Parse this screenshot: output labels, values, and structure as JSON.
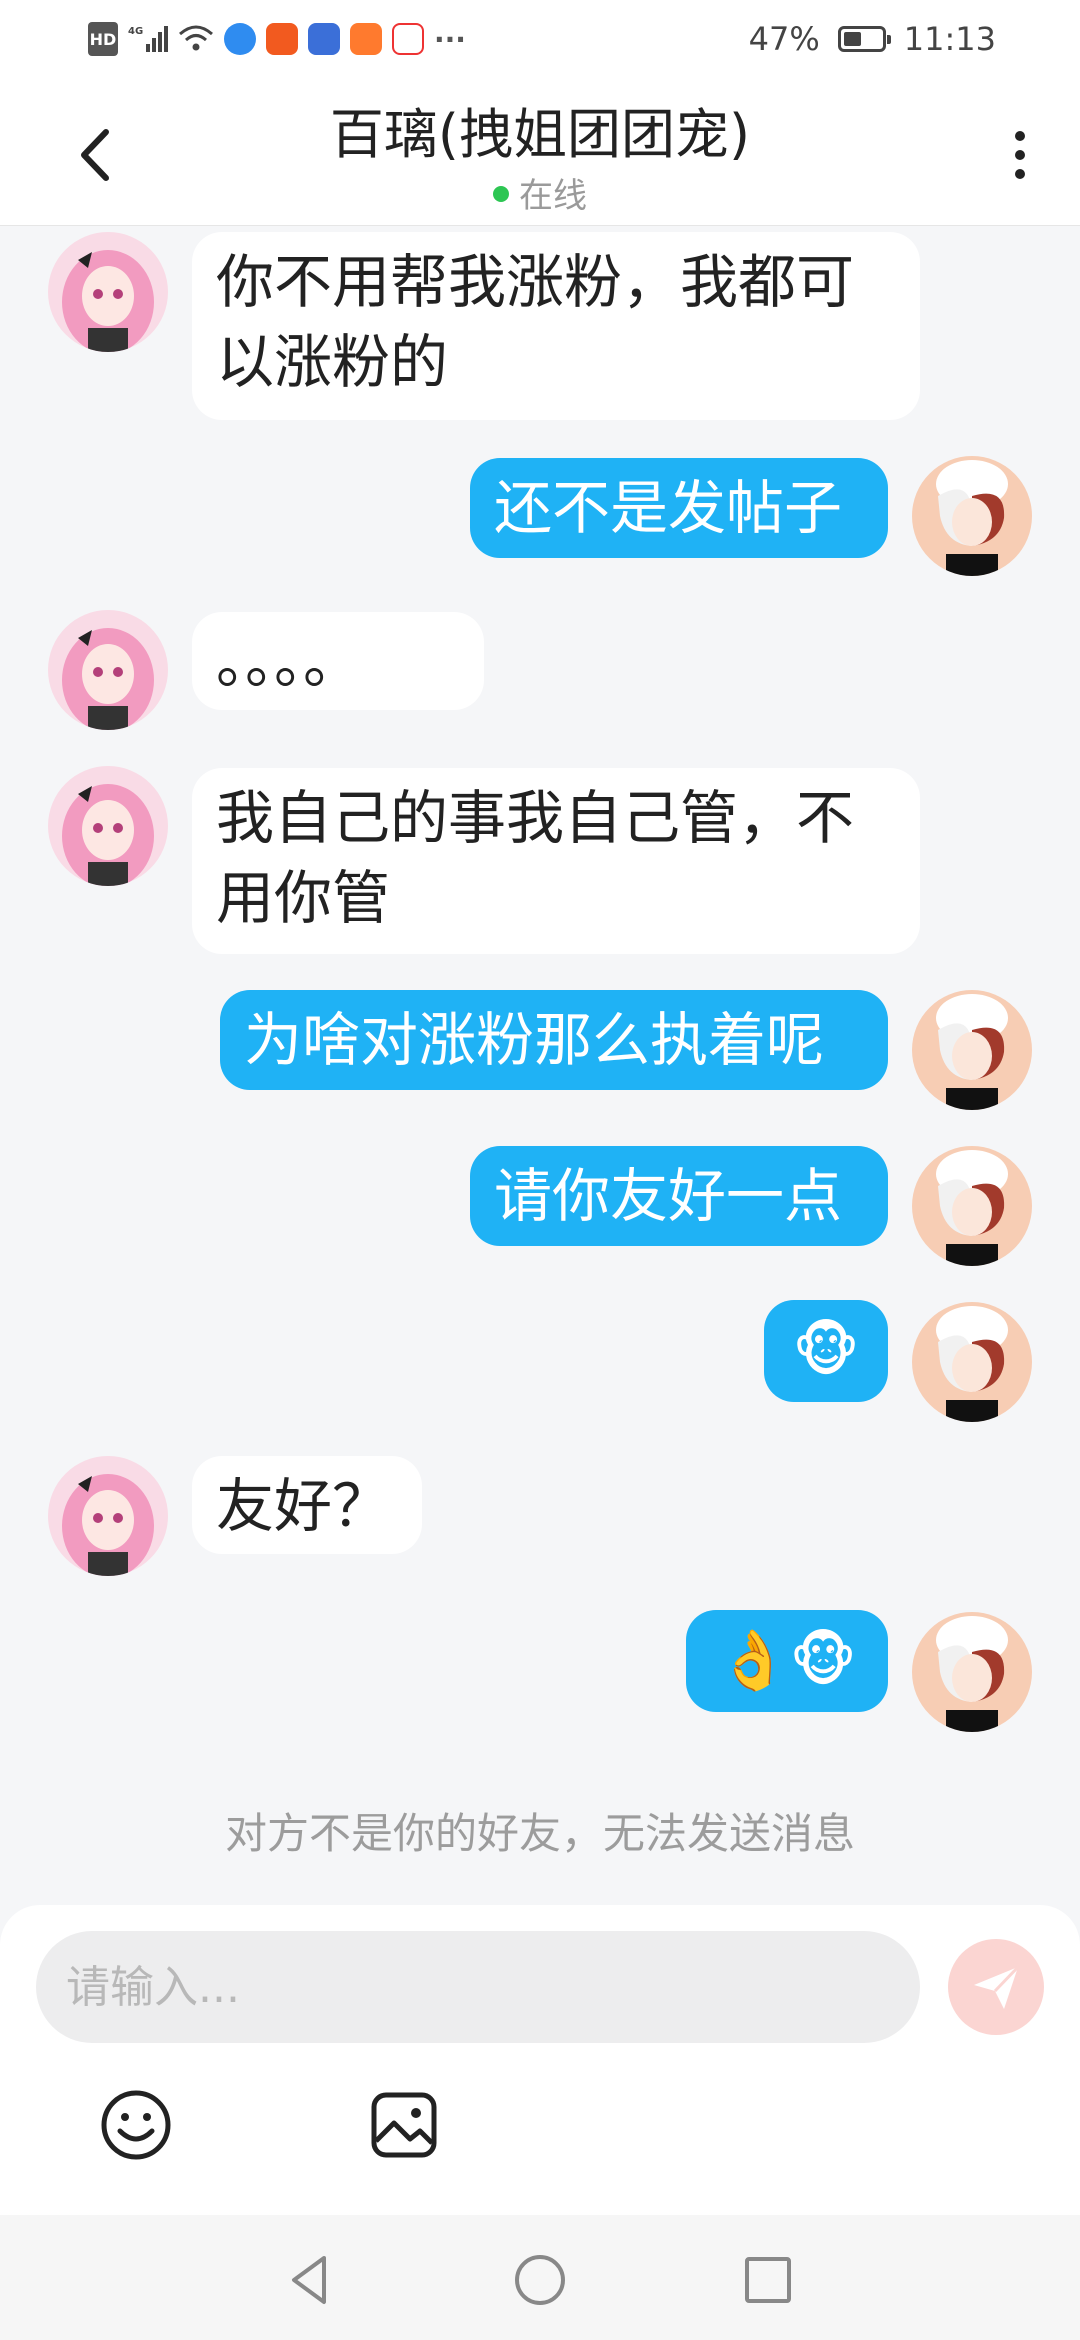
{
  "status_bar": {
    "network": "4G",
    "battery": "47%",
    "battery_level": 0.47,
    "time": "11:13",
    "more": "···"
  },
  "header": {
    "title": "百璃(拽姐团团宠)",
    "status": "在线"
  },
  "messages": [
    {
      "side": "in",
      "text": "你不用帮我涨粉，我都可以涨粉的"
    },
    {
      "side": "out",
      "text": "还不是发帖子"
    },
    {
      "side": "in",
      "text": "。。。。"
    },
    {
      "side": "in",
      "text": "我自己的事我自己管，不用你管"
    },
    {
      "side": "out",
      "text": "为啥对涨粉那么执着呢"
    },
    {
      "side": "out",
      "text": "请你友好一点"
    },
    {
      "side": "out",
      "text": "🐵"
    },
    {
      "side": "in",
      "text": "友好？"
    },
    {
      "side": "out",
      "text": "👌🐵"
    }
  ],
  "notice": "对方不是你的好友，无法发送消息",
  "composer": {
    "placeholder": "请输入..."
  },
  "colors": {
    "outgoing_bubble": "#1fb2f5",
    "incoming_bubble": "#ffffff",
    "online_dot": "#2dc653",
    "send_button": "#fbd5d2"
  },
  "icons": [
    "back-icon",
    "more-icon",
    "send-icon",
    "emoji-icon",
    "image-icon",
    "nav-back-icon",
    "nav-home-icon",
    "nav-recents-icon"
  ]
}
